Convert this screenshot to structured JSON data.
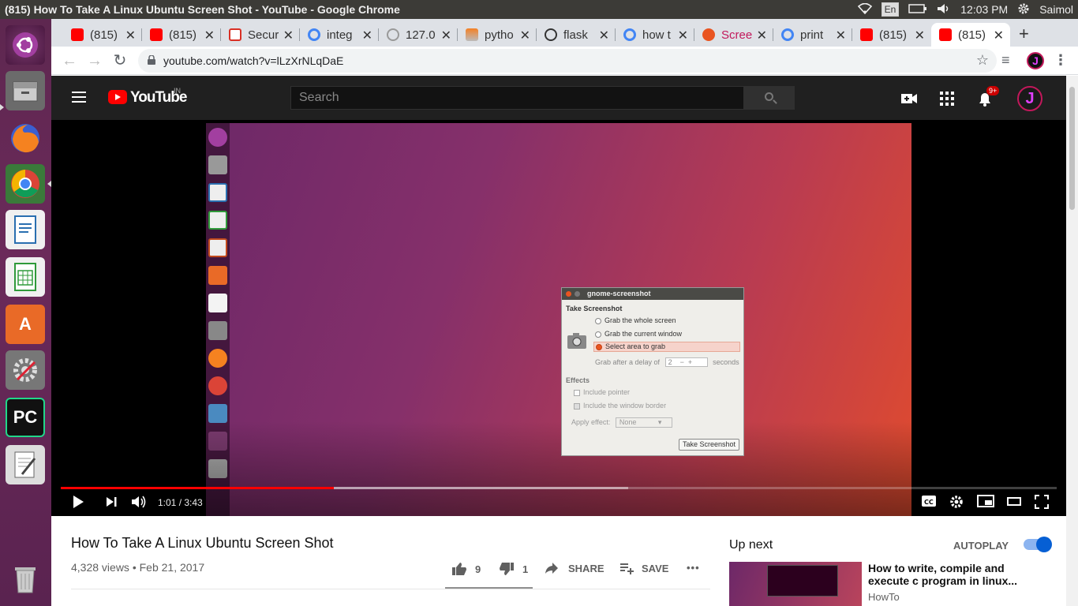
{
  "os": {
    "window_title": "(815) How To Take A Linux Ubuntu Screen Shot - YouTube - Google Chrome",
    "keyboard_layout": "En",
    "clock": "12:03 PM",
    "user": "Saimol"
  },
  "launcher": {
    "items": [
      "ubuntu-dash",
      "files",
      "firefox",
      "chrome",
      "libreoffice-writer",
      "libreoffice-calc",
      "software-center",
      "system-settings",
      "pycharm",
      "text-editor",
      "trash"
    ]
  },
  "tabs": [
    {
      "label": "(815)",
      "icon": "youtube-icon"
    },
    {
      "label": "(815)",
      "icon": "youtube-icon"
    },
    {
      "label": "Secur",
      "icon": "gmail-icon"
    },
    {
      "label": "integ",
      "icon": "google-icon"
    },
    {
      "label": "127.0",
      "icon": "globe-icon"
    },
    {
      "label": "pytho",
      "icon": "stackoverflow-icon"
    },
    {
      "label": "flask",
      "icon": "flask-icon"
    },
    {
      "label": "how t",
      "icon": "google-icon"
    },
    {
      "label": "Scree",
      "icon": "ubuntu-icon"
    },
    {
      "label": "print",
      "icon": "google-icon"
    },
    {
      "label": "(815)",
      "icon": "youtube-icon"
    },
    {
      "label": "(815)",
      "icon": "youtube-icon",
      "active": true
    }
  ],
  "browser": {
    "url": "youtube.com/watch?v=lLzXrNLqDaE",
    "profile_initial": "J"
  },
  "youtube": {
    "logo_text": "YouTube",
    "country": "IN",
    "search_placeholder": "Search",
    "notifications": "9+",
    "avatar_initial": "J"
  },
  "video_frame": {
    "dialog_title": "gnome-screenshot",
    "heading": "Take Screenshot",
    "opt_whole": "Grab the whole screen",
    "opt_window": "Grab the current window",
    "opt_area": "Select area to grab",
    "delay_label": "Grab after a delay of",
    "delay_value": "2",
    "delay_unit": "seconds",
    "effects_heading": "Effects",
    "include_pointer": "Include pointer",
    "include_border": "Include the window border",
    "apply_effect_label": "Apply effect:",
    "apply_effect_value": "None",
    "take_button": "Take Screenshot"
  },
  "player": {
    "time": "1:01 / 3:43",
    "played_fraction": 0.274,
    "buffered_fraction": 0.57
  },
  "video": {
    "title": "How To Take A Linux Ubuntu Screen Shot",
    "meta": "4,328 views • Feb 21, 2017",
    "likes": "9",
    "dislikes": "1",
    "share": "SHARE",
    "save": "SAVE",
    "more": "•••"
  },
  "sidebar": {
    "up_next": "Up next",
    "autoplay": "AUTOPLAY",
    "next_title": "How to write, compile and execute c program in linux...",
    "next_channel": "HowTo"
  },
  "colors": {
    "youtube_red": "#ff0000",
    "ubuntu_orange": "#e95420",
    "masthead": "#202020",
    "toggle_blue": "#065fd4"
  }
}
